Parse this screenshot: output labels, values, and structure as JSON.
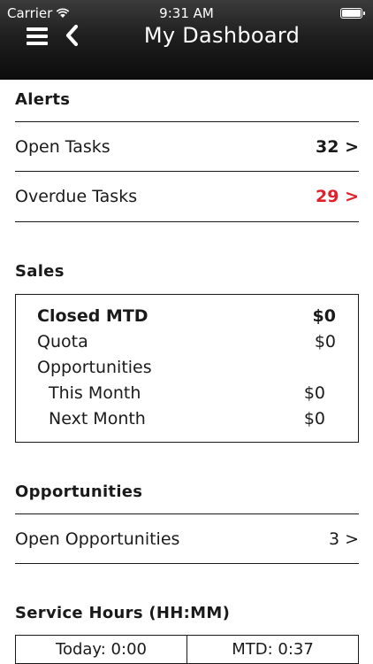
{
  "status_bar": {
    "carrier": "Carrier",
    "time": "9:31 AM"
  },
  "header": {
    "title": "My Dashboard"
  },
  "alerts": {
    "title": "Alerts",
    "rows": [
      {
        "label": "Open Tasks",
        "value": "32 >",
        "color": "#111111"
      },
      {
        "label": "Overdue Tasks",
        "value": "29 >",
        "color": "#e0202a"
      }
    ]
  },
  "sales": {
    "title": "Sales",
    "lines": [
      {
        "label": "Closed MTD",
        "value": "$0"
      },
      {
        "label": "Quota",
        "value": "$0"
      },
      {
        "label": "Opportunities",
        "value": ""
      },
      {
        "label": "This Month",
        "value": "$0"
      },
      {
        "label": "Next Month",
        "value": "$0"
      }
    ]
  },
  "opportunities": {
    "title": "Opportunities",
    "rows": [
      {
        "label": "Open Opportunities",
        "value": "3 >"
      }
    ]
  },
  "service_hours": {
    "title": "Service Hours (HH:MM)",
    "today": "Today: 0:00",
    "mtd": "MTD: 0:37"
  }
}
